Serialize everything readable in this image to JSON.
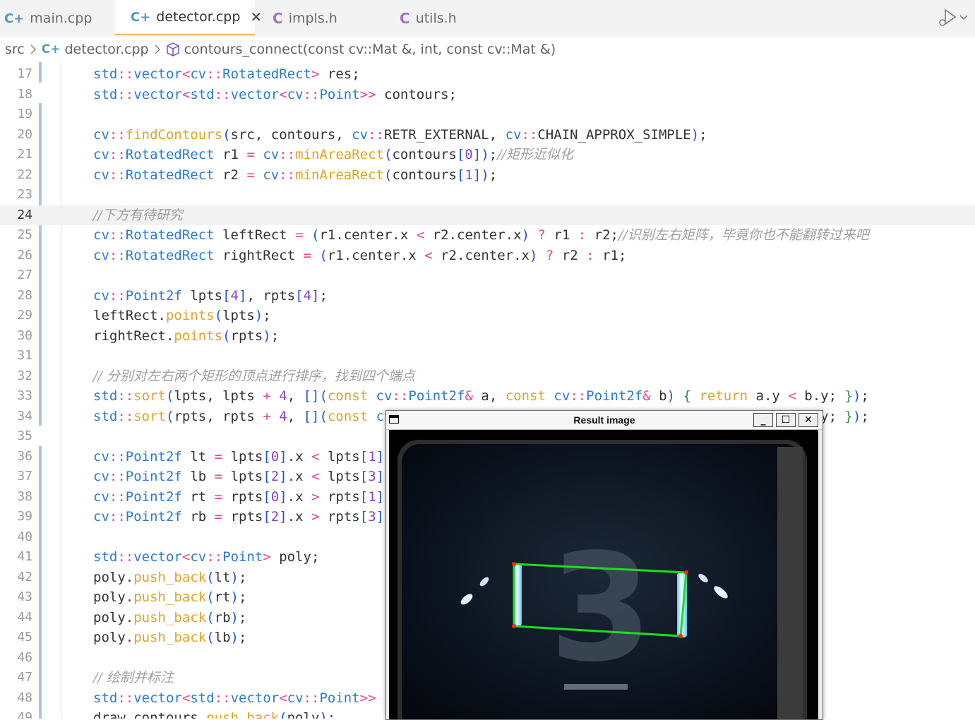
{
  "tabs": [
    {
      "label": "main.cpp",
      "icon": "C++",
      "active": false
    },
    {
      "label": "detector.cpp",
      "icon": "C++",
      "active": true
    },
    {
      "label": "impls.h",
      "icon": "C",
      "active": false
    },
    {
      "label": "utils.h",
      "icon": "C",
      "active": false
    }
  ],
  "tab_close_glyph": "✕",
  "breadcrumb": {
    "folder": "src",
    "file": "detector.cpp",
    "symbol": "contours_connect(const cv::Mat &, int, const cv::Mat &)"
  },
  "colors": {
    "accent_tab": "#e8b866",
    "keyword": "#e0a325",
    "namespace": "#2b7bd1",
    "operator": "#e84393",
    "number": "#8b44c4",
    "comment": "#9e9e9e"
  },
  "editor": {
    "current_line": "24",
    "lines": [
      {
        "n": "17",
        "text": "std::vector<cv::RotatedRect> res;"
      },
      {
        "n": "18",
        "text": "std::vector<std::vector<cv::Point>> contours;"
      },
      {
        "n": "19",
        "text": ""
      },
      {
        "n": "20",
        "text": "cv::findContours(src, contours, cv::RETR_EXTERNAL, cv::CHAIN_APPROX_SIMPLE);"
      },
      {
        "n": "21",
        "text": "cv::RotatedRect r1 = cv::minAreaRect(contours[0]);//矩形近似化"
      },
      {
        "n": "22",
        "text": "cv::RotatedRect r2 = cv::minAreaRect(contours[1]);"
      },
      {
        "n": "23",
        "text": ""
      },
      {
        "n": "24",
        "text": "//下方有待研究"
      },
      {
        "n": "25",
        "text": "cv::RotatedRect leftRect = (r1.center.x < r2.center.x) ? r1 : r2;//识别左右矩阵，毕竟你也不能翻转过来吧"
      },
      {
        "n": "26",
        "text": "cv::RotatedRect rightRect = (r1.center.x < r2.center.x) ? r2 : r1;"
      },
      {
        "n": "27",
        "text": ""
      },
      {
        "n": "28",
        "text": "cv::Point2f lpts[4], rpts[4];"
      },
      {
        "n": "29",
        "text": "leftRect.points(lpts);"
      },
      {
        "n": "30",
        "text": "rightRect.points(rpts);"
      },
      {
        "n": "31",
        "text": ""
      },
      {
        "n": "32",
        "text": "// 分别对左右两个矩形的顶点进行排序，找到四个端点"
      },
      {
        "n": "33",
        "text": "std::sort(lpts, lpts + 4, [](const cv::Point2f& a, const cv::Point2f& b) { return a.y < b.y; });"
      },
      {
        "n": "34",
        "text": "std::sort(rpts, rpts + 4, [](const cv::Point2f& a, const cv::Point2f& b) { return a.y < b.y; });"
      },
      {
        "n": "35",
        "text": ""
      },
      {
        "n": "36",
        "text": "cv::Point2f lt = lpts[0].x < lpts[1]"
      },
      {
        "n": "37",
        "text": "cv::Point2f lb = lpts[2].x < lpts[3]"
      },
      {
        "n": "38",
        "text": "cv::Point2f rt = rpts[0].x > rpts[1]"
      },
      {
        "n": "39",
        "text": "cv::Point2f rb = rpts[2].x > rpts[3]"
      },
      {
        "n": "40",
        "text": ""
      },
      {
        "n": "41",
        "text": "std::vector<cv::Point> poly;"
      },
      {
        "n": "42",
        "text": "poly.push_back(lt);"
      },
      {
        "n": "43",
        "text": "poly.push_back(rt);"
      },
      {
        "n": "44",
        "text": "poly.push_back(rb);"
      },
      {
        "n": "45",
        "text": "poly.push_back(lb);"
      },
      {
        "n": "46",
        "text": ""
      },
      {
        "n": "47",
        "text": "// 绘制并标注"
      },
      {
        "n": "48",
        "text": "std::vector<std::vector<cv::Point>>"
      },
      {
        "n": "49",
        "text": "draw_contours.push_back(poly);"
      }
    ]
  },
  "result_window": {
    "title": "Result image",
    "minimize": "_",
    "maximize": "☐",
    "close": "✕",
    "digit": "3"
  }
}
